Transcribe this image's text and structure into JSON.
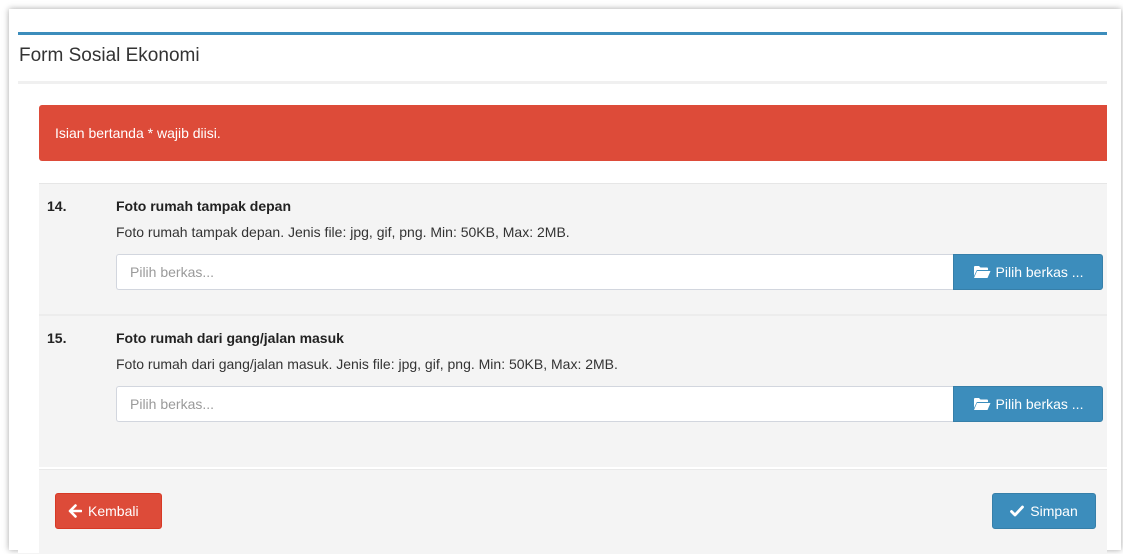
{
  "panel": {
    "title": "Form Sosial Ekonomi"
  },
  "alert": {
    "message": "Isian bertanda * wajib diisi."
  },
  "fields": [
    {
      "number": "14.",
      "title": "Foto rumah tampak depan",
      "description": "Foto rumah tampak depan. Jenis file: jpg, gif, png. Min: 50KB, Max: 2MB.",
      "placeholder": "Pilih berkas...",
      "button_label": "Pilih berkas ..."
    },
    {
      "number": "15.",
      "title": "Foto rumah dari gang/jalan masuk",
      "description": "Foto rumah dari gang/jalan masuk. Jenis file: jpg, gif, png. Min: 50KB, Max: 2MB.",
      "placeholder": "Pilih berkas...",
      "button_label": "Pilih berkas ..."
    }
  ],
  "footer": {
    "back_label": "Kembali",
    "save_label": "Simpan"
  },
  "icons": {
    "back": "arrow-left-icon",
    "folder": "folder-open-icon",
    "save": "check-icon"
  },
  "colors": {
    "primary": "#3c8dbc",
    "danger": "#dd4b39",
    "panel_bg": "#f4f4f4"
  }
}
